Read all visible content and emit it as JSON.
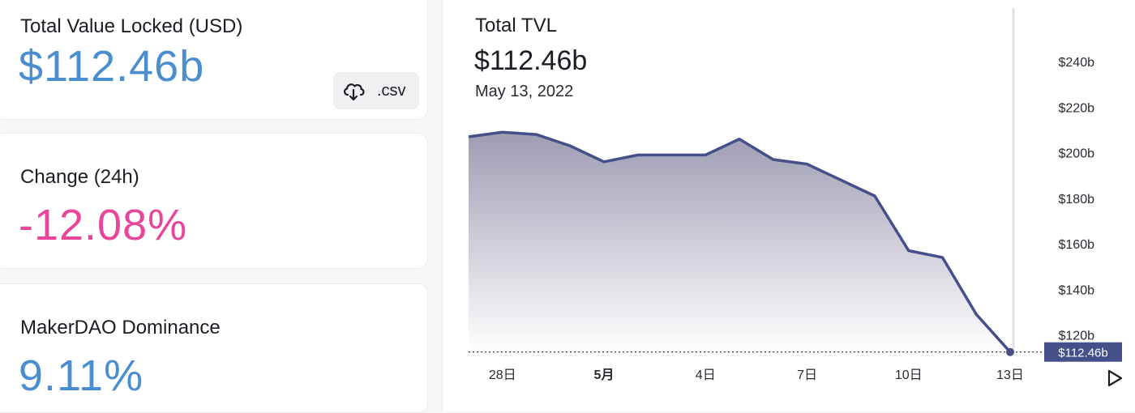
{
  "tvl_card": {
    "label": "Total Value Locked (USD)",
    "value": "$112.46b",
    "csv_label": ".csv",
    "value_color": "#4a8ecf"
  },
  "change_card": {
    "label": "Change (24h)",
    "value": "-12.08%",
    "value_color": "#e8469a"
  },
  "dominance_card": {
    "label": "MakerDAO Dominance",
    "value": "9.11%",
    "value_color": "#4a8ecf"
  },
  "chart": {
    "title": "Total TVL",
    "value": "$112.46b",
    "date": "May 13, 2022",
    "line_color": "#45508a"
  },
  "chart_data": {
    "type": "area",
    "title": "Total TVL",
    "x": [
      "4/27",
      "4/28",
      "4/29",
      "4/30",
      "5/1",
      "5/2",
      "5/3",
      "5/4",
      "5/5",
      "5/6",
      "5/7",
      "5/8",
      "5/9",
      "5/10",
      "5/11",
      "5/12",
      "5/13"
    ],
    "values": [
      207,
      209,
      208,
      203,
      196,
      199,
      199,
      199,
      206,
      197,
      195,
      188,
      181,
      157,
      154,
      129,
      112.46
    ],
    "ylim": [
      112,
      250
    ],
    "y_ticks": [
      240,
      220,
      200,
      180,
      160,
      140,
      120
    ],
    "y_tick_labels": [
      "$240b",
      "$220b",
      "$200b",
      "$180b",
      "$160b",
      "$140b",
      "$120b"
    ],
    "x_tick_labels": [
      {
        "label": "28日",
        "at": "4/28",
        "bold": false
      },
      {
        "label": "5月",
        "at": "5/1",
        "bold": true
      },
      {
        "label": "4日",
        "at": "5/4",
        "bold": false
      },
      {
        "label": "7日",
        "at": "5/7",
        "bold": false
      },
      {
        "label": "10日",
        "at": "5/10",
        "bold": false
      },
      {
        "label": "13日",
        "at": "5/13",
        "bold": false
      }
    ],
    "current_label": "$112.46b",
    "grid": false
  }
}
